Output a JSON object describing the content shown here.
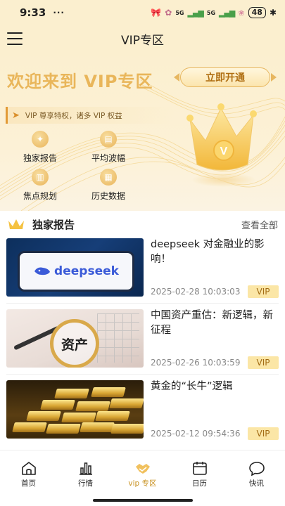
{
  "status_bar": {
    "time": "9:33",
    "dots": "···",
    "battery": "48",
    "signal_1": "5G",
    "signal_2": "5G"
  },
  "header": {
    "title": "VIP专区"
  },
  "hero": {
    "title": "欢迎来到 VIP专区",
    "open_button": "立即开通",
    "perk_text": "VIP 尊享特权，诸多 VIP 权益",
    "features": [
      {
        "label": "独家报告",
        "icon": "report-icon"
      },
      {
        "label": "平均波幅",
        "icon": "chart-icon"
      },
      {
        "label": "焦点规划",
        "icon": "bar-chart-icon"
      },
      {
        "label": "历史数据",
        "icon": "history-icon"
      }
    ],
    "crown_letter": "V"
  },
  "section": {
    "title": "独家报告",
    "see_all": "查看全部"
  },
  "articles": [
    {
      "headline": "deepseek 对金融业的影响！",
      "time": "2025-02-28 10:03:03",
      "badge": "VIP",
      "thumb_text": "deepseek"
    },
    {
      "headline": "中国资产重估：新逻辑，新征程",
      "time": "2025-02-26 10:03:59",
      "badge": "VIP",
      "thumb_text": "资产"
    },
    {
      "headline": "黄金的“长牛”逻辑",
      "time": "2025-02-12 09:54:36",
      "badge": "VIP"
    }
  ],
  "nav": {
    "tabs": [
      {
        "label": "首页",
        "icon": "home-icon"
      },
      {
        "label": "行情",
        "icon": "market-icon"
      },
      {
        "label": "vip 专区",
        "icon": "vip-handshake-icon",
        "active": true
      },
      {
        "label": "日历",
        "icon": "calendar-icon"
      },
      {
        "label": "快讯",
        "icon": "chat-icon"
      }
    ]
  },
  "colors": {
    "accent": "#e9b65a",
    "active_tab": "#c8901e",
    "badge_bg": "#fbe6a6"
  }
}
